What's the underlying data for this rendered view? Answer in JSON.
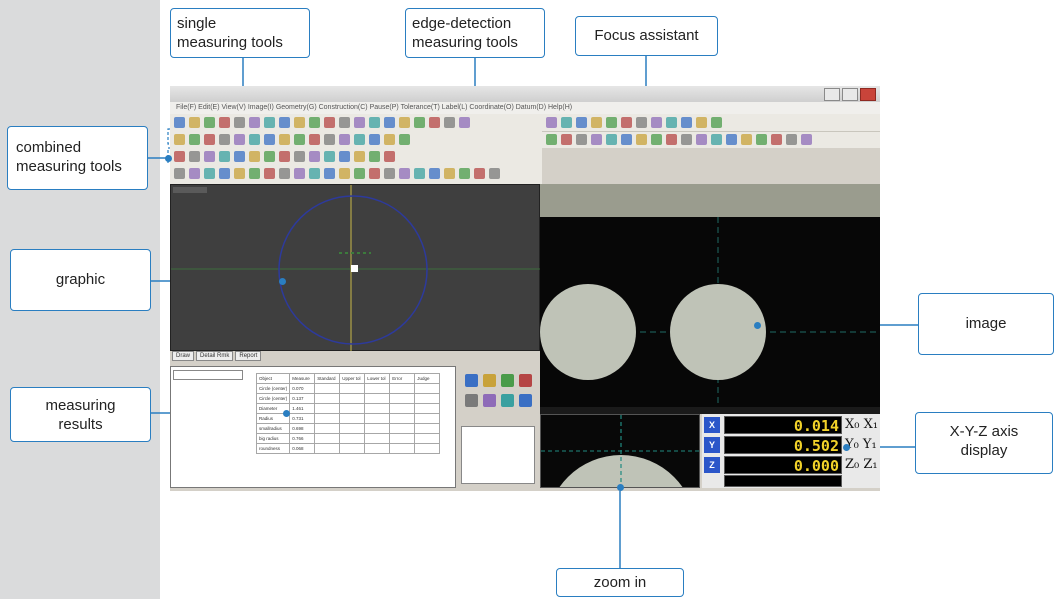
{
  "callouts": {
    "single_tools": [
      "single",
      "measuring tools"
    ],
    "edge_tools": [
      "edge-detection",
      "measuring tools"
    ],
    "focus": "Focus assistant",
    "combined_tools": [
      "combined",
      "measuring tools"
    ],
    "graphic": "graphic",
    "image": "image",
    "results": [
      "measuring",
      "results"
    ],
    "xyz": [
      "X-Y-Z axis",
      "display"
    ],
    "zoom": "zoom in"
  },
  "software": {
    "menu": "File(F)  Edit(E)  View(V)  Image(I)  Geometry(G)  Construction(C)  Pause(P)  Tolerance(T)  Label(L)  Coordinate(O)  Datum(D)  Help(H)",
    "graphic_tabs": [
      "Draw",
      "Detail Rmk",
      "Report"
    ],
    "results_table": [
      [
        "Object",
        "Measure",
        "Standard",
        "Upper tol",
        "Lower tol",
        "Error",
        "Judge"
      ],
      [
        "Circle (center)",
        "0.070",
        "",
        "",
        "",
        "",
        ""
      ],
      [
        "Circle (center)",
        "0.137",
        "",
        "",
        "",
        "",
        ""
      ],
      [
        "Diameter",
        "1.461",
        "",
        "",
        "",
        "",
        ""
      ],
      [
        "Radius",
        "0.731",
        "",
        "",
        "",
        "",
        ""
      ],
      [
        "smallradius",
        "0.698",
        "",
        "",
        "",
        "",
        ""
      ],
      [
        "big radius",
        "0.766",
        "",
        "",
        "",
        "",
        ""
      ],
      [
        "roundness",
        "0.068",
        "",
        "",
        "",
        "",
        ""
      ]
    ],
    "axis": [
      {
        "label": "X",
        "value": "0.014",
        "side": "X₀ X₁"
      },
      {
        "label": "Y",
        "value": "0.502",
        "side": "Y₀ Y₁"
      },
      {
        "label": "Z",
        "value": "0.000",
        "side": "Z₀ Z₁"
      }
    ]
  },
  "colors": {
    "callout_border": "#2a7ec1",
    "axis_digits": "#f2d229",
    "axis_label_bg": "#2b56c9"
  }
}
